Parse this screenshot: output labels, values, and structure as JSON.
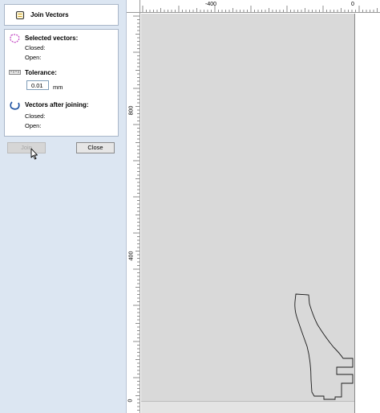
{
  "panel": {
    "title": "Join Vectors",
    "selected": {
      "title": "Selected vectors:",
      "closed_label": "Closed:",
      "open_label": "Open:"
    },
    "tolerance": {
      "title": "Tolerance:",
      "value": "0.01",
      "unit": "mm"
    },
    "after": {
      "title": "Vectors after joining:",
      "closed_label": "Closed:",
      "open_label": "Open:"
    },
    "buttons": {
      "join": "Join",
      "close": "Close"
    }
  },
  "ruler": {
    "top_labels": [
      "-400",
      "0"
    ],
    "left_labels": [
      "800",
      "400",
      "0"
    ]
  },
  "icons": [
    "join-vectors-icon",
    "selected-vectors-icon",
    "tolerance-icon",
    "vectors-after-joining-icon",
    "mouse-cursor-icon"
  ]
}
